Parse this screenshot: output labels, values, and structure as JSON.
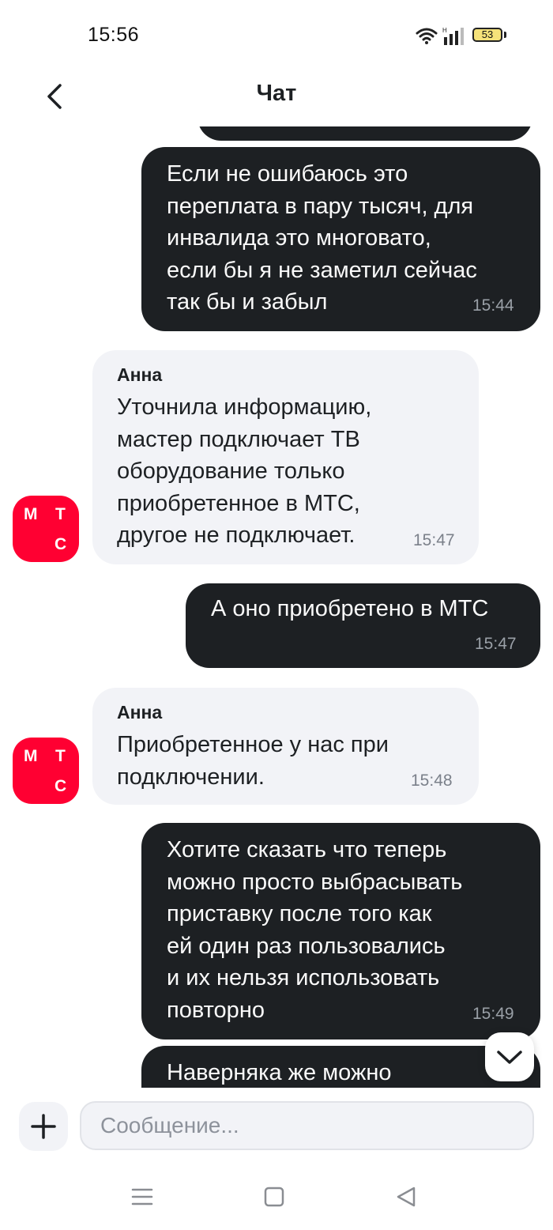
{
  "status_bar": {
    "time": "15:56",
    "battery": "53"
  },
  "header": {
    "title": "Чат"
  },
  "messages": [
    {
      "direction": "out",
      "text": "Если не ошибаюсь это\nпереплата в пару тысяч, для\nинвалида это многовато,\nесли бы я не заметил сейчас\nтак бы и забыл",
      "time": "15:44"
    },
    {
      "direction": "in",
      "sender": "Анна",
      "text": "Уточнила информацию,\nмастер подключает ТВ\nоборудование только\nприобретенное в МТС,\nдругое не подключает.",
      "time": "15:47"
    },
    {
      "direction": "out",
      "text": "А оно приобретено в МТС",
      "time": "15:47"
    },
    {
      "direction": "in",
      "sender": "Анна",
      "text": "Приобретенное у нас при\nподключении.",
      "time": "15:48"
    },
    {
      "direction": "out",
      "text": "Хотите сказать что теперь\nможно просто выбрасывать\nприставку после того как\nей один раз пользовались\nи их нельзя использовать\nповторно",
      "time": "15:49"
    },
    {
      "direction": "out",
      "text": "Наверняка же можно",
      "time": ""
    }
  ],
  "avatar": {
    "letters": [
      "М",
      "Т",
      "С"
    ],
    "color": "#ff0032"
  },
  "composer": {
    "placeholder": "Сообщение..."
  },
  "colors": {
    "outgoing_bubble": "#1d2023",
    "incoming_bubble": "#f2f3f7",
    "brand": "#ff0032"
  }
}
